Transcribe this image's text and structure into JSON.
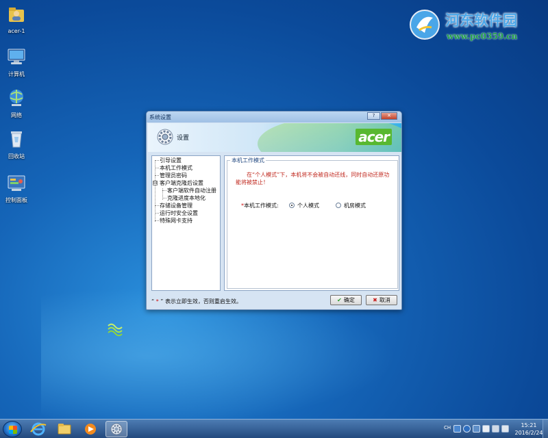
{
  "desktop": {
    "icons": [
      {
        "label": "acer-1",
        "icon": "user-folder-icon"
      },
      {
        "label": "计算机",
        "icon": "computer-icon"
      },
      {
        "label": "网络",
        "icon": "network-icon"
      },
      {
        "label": "回收站",
        "icon": "recycle-bin-icon"
      },
      {
        "label": "控制面板",
        "icon": "control-panel-icon"
      }
    ]
  },
  "watermark": {
    "title": "河东软件园",
    "url": "www.pc0359.cn"
  },
  "dialog": {
    "title": "系统设置",
    "banner_title": "设置",
    "brand": "acer",
    "title_buttons": [
      "?",
      "✕"
    ],
    "tree": [
      {
        "label": "引导设置",
        "level": 0
      },
      {
        "label": "本机工作模式",
        "level": 0
      },
      {
        "label": "管理员密码",
        "level": 0
      },
      {
        "label": "客户端克隆后设置",
        "level": 0,
        "expander": "⊟"
      },
      {
        "label": "客户端软件自动注册",
        "level": 1
      },
      {
        "label": "克隆进度本地化",
        "level": 1
      },
      {
        "label": "存储设备管理",
        "level": 0
      },
      {
        "label": "运行时安全设置",
        "level": 0
      },
      {
        "label": "特殊网卡支持",
        "level": 0
      }
    ],
    "group_title": "本机工作模式",
    "warning": "在“个人模式”下，本机将不会被自动还线，同时自动还原功能将被禁止！",
    "mode_star": "*",
    "mode_label": "本机工作模式:",
    "mode_options": [
      {
        "label": "个人模式",
        "selected": true
      },
      {
        "label": "机房模式",
        "selected": false
      }
    ],
    "footer_prefix": "“",
    "footer_star": "*",
    "footer_text": "” 表示立即生效，否则重启生效。",
    "ok_label": "确定",
    "cancel_label": "取消"
  },
  "taskbar": {
    "apps": [
      "internet-explorer-icon",
      "file-explorer-icon",
      "media-player-icon",
      "settings-app-icon"
    ],
    "active_app": "settings-app-icon",
    "language": "CH",
    "time": "15:21",
    "date": "2016/2/24"
  },
  "colors": {
    "desktop_blue": "#1565b8",
    "warning_red": "#c0281e",
    "acer_green": "#58b830",
    "taskbar": "#2f5d96"
  }
}
